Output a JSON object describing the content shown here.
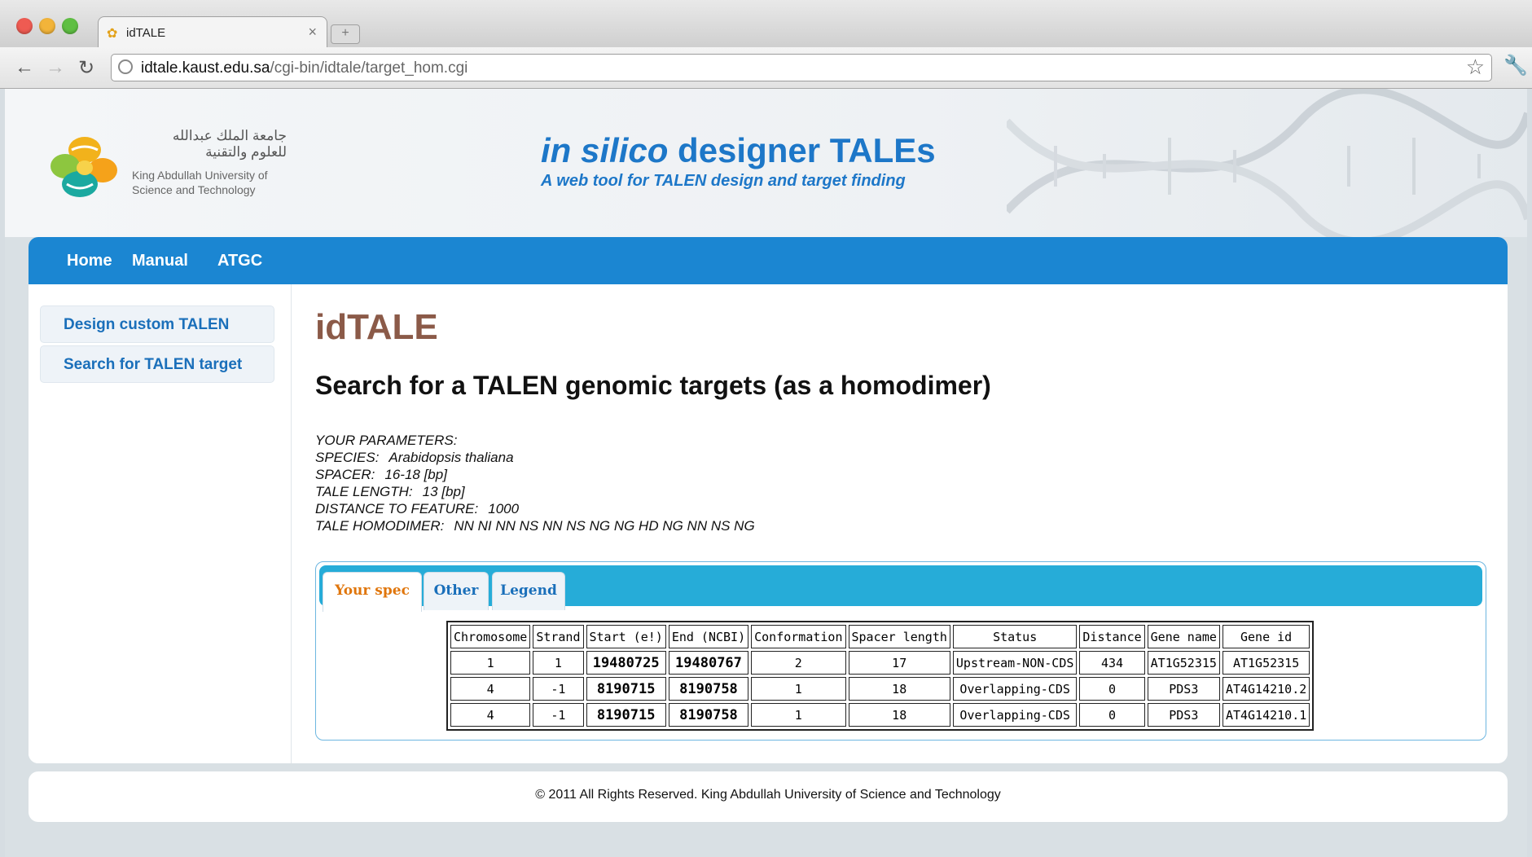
{
  "browser": {
    "tab_title": "idTALE",
    "url_host": "idtale.kaust.edu.sa",
    "url_path": "/cgi-bin/idtale/target_hom.cgi"
  },
  "header": {
    "arabic_line1": "جامعة الملك عبدالله",
    "arabic_line2": "للعلوم والتقنية",
    "kaust_en_line1": "King Abdullah University of",
    "kaust_en_line2": "Science and Technology",
    "title_italic": "in silico",
    "title_rest": " designer TALEs",
    "subtitle": "A web tool for TALEN design and target finding"
  },
  "nav": {
    "items": [
      {
        "label": "Home"
      },
      {
        "label": "Manual"
      },
      {
        "label": "ATGC"
      }
    ]
  },
  "sidebar": {
    "items": [
      {
        "label": "Design custom TALEN"
      },
      {
        "label": "Search for TALEN target"
      }
    ]
  },
  "main": {
    "title": "idTALE",
    "heading": "Search for a TALEN genomic targets (as a homodimer)",
    "params_header": "YOUR PARAMETERS:",
    "params": [
      {
        "label": "SPECIES:",
        "value": "Arabidopsis thaliana"
      },
      {
        "label": "SPACER:",
        "value": "16-18 [bp]"
      },
      {
        "label": "TALE LENGTH:",
        "value": "13 [bp]"
      },
      {
        "label": "DISTANCE TO FEATURE:",
        "value": "1000"
      },
      {
        "label": "TALE HOMODIMER:",
        "value": "NN NI NN NS NN NS NG NG HD NG NN NS NG"
      }
    ],
    "tabs": [
      {
        "label": "Your spec",
        "active": true
      },
      {
        "label": "Other",
        "active": false
      },
      {
        "label": "Legend",
        "active": false
      }
    ],
    "table": {
      "columns": [
        "Chromosome",
        "Strand",
        "Start (e!)",
        "End (NCBI)",
        "Conformation",
        "Spacer length",
        "Status",
        "Distance",
        "Gene name",
        "Gene id"
      ],
      "rows": [
        [
          "1",
          "1",
          "19480725",
          "19480767",
          "2",
          "17",
          "Upstream-NON-CDS",
          "434",
          "AT1G52315",
          "AT1G52315"
        ],
        [
          "4",
          "-1",
          "8190715",
          "8190758",
          "1",
          "18",
          "Overlapping-CDS",
          "0",
          "PDS3",
          "AT4G14210.2"
        ],
        [
          "4",
          "-1",
          "8190715",
          "8190758",
          "1",
          "18",
          "Overlapping-CDS",
          "0",
          "PDS3",
          "AT4G14210.1"
        ]
      ]
    }
  },
  "footer": {
    "text": "© 2011 All Rights Reserved. King Abdullah University of Science and Technology"
  },
  "colors": {
    "nav_blue": "#1b86d2",
    "tabs_cyan": "#26acd8",
    "title_brown": "#8b5a48",
    "active_tab_orange": "#e0760c"
  }
}
